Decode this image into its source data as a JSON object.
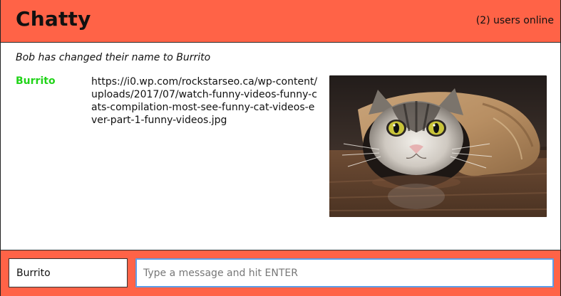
{
  "navbar": {
    "brand": "Chatty",
    "users_online": "(2) users online"
  },
  "messages": {
    "notification": "Bob has changed their name to Burrito",
    "items": [
      {
        "username": "Burrito",
        "username_color": "#22d41a",
        "text": "https://i0.wp.com/rockstarseo.ca/wp-content/uploads/2017/07/watch-funny-videos-funny-cats-compilation-most-see-funny-cat-videos-ever-part-1-funny-videos.jpg",
        "image_subject": "cat-wrapped-in-paper"
      }
    ]
  },
  "chatbar": {
    "username_value": "Burrito",
    "message_placeholder": "Type a message and hit ENTER",
    "message_value": ""
  },
  "colors": {
    "accent": "#ff6347",
    "input_focus": "#5b9de8"
  }
}
